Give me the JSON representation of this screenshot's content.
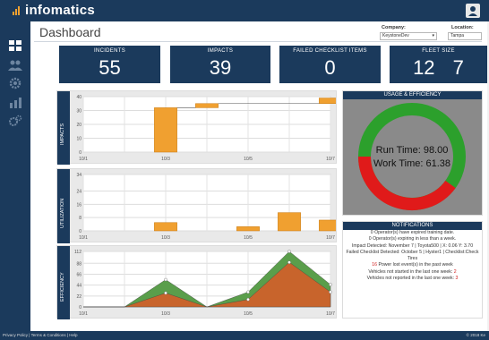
{
  "app": {
    "logo": "infomatics"
  },
  "page": {
    "title": "Dashboard"
  },
  "filters": {
    "company": {
      "label": "Company:",
      "value": "KeystoneDev"
    },
    "location": {
      "label": "Location:",
      "value": "Tampa"
    }
  },
  "kpis": [
    {
      "label": "INCIDENTS",
      "value": "55"
    },
    {
      "label": "IMPACTS",
      "value": "39"
    },
    {
      "label": "FAILED CHECKLIST ITEMS",
      "value": "0"
    },
    {
      "label": "FLEET SIZE",
      "value": "12",
      "value2": "7"
    }
  ],
  "sidebar": {
    "items": [
      {
        "icon": "dashboard-icon"
      },
      {
        "icon": "users-icon"
      },
      {
        "icon": "settings-icon"
      },
      {
        "icon": "reports-icon"
      },
      {
        "icon": "gears-icon"
      }
    ]
  },
  "usage": {
    "header": "USAGE & EFFICIENCY",
    "run_time": "Run Time: 98.00",
    "work_time": "Work Time: 61.38",
    "colors": {
      "run": "#2ca02c",
      "work": "#e01a1a",
      "panel": "#8a8a8a"
    }
  },
  "notifications": {
    "header": "NOTIFICATIONS",
    "lines": [
      {
        "text": "0 Operator(s) have expired training date.",
        "alert": false
      },
      {
        "text": "0 Operator(s) expiring in less than a week.",
        "alert": false
      },
      {
        "text": "Impact Detected: November 7 | Toyota500 | X: 0.06 Y: 3.70",
        "alert": false
      },
      {
        "text": "Failed Checklist Detected: October 5 | Hyster1 | Checklist:Check Tires",
        "alert": false
      },
      {
        "prefix": "16",
        "text": " Power lost event(s) in the past week",
        "alert": true
      },
      {
        "text": "Vehicles not started in the last one week: ",
        "suffix": "2",
        "alert": true
      },
      {
        "text": "Vehicles not reported in the last one week: ",
        "suffix": "3",
        "alert": true
      }
    ]
  },
  "footer": {
    "links": "Privacy Policy | Terms & Conditions | Help",
    "copyright": "© 2018 Ke"
  },
  "chart_data": [
    {
      "type": "bar",
      "ylabel": "IMPACTS",
      "x_ticks": [
        "10/1",
        "10/3",
        "10/5",
        "10/7"
      ],
      "y_ticks": [
        0,
        10,
        20,
        30,
        40
      ],
      "ylim": [
        0,
        40
      ],
      "bars": [
        {
          "x": "10/3",
          "low": 0,
          "high": 32
        },
        {
          "x": "10/4",
          "low": 32,
          "high": 35
        },
        {
          "x": "10/7",
          "low": 35,
          "high": 39
        }
      ],
      "grid": true,
      "colors": {
        "bar": "#f0a030"
      }
    },
    {
      "type": "bar",
      "ylabel": "UTILIZATION",
      "x_ticks": [
        "10/1",
        "10/3",
        "10/5",
        "10/7"
      ],
      "y_ticks": [
        0,
        8,
        16,
        24,
        34
      ],
      "ylim": [
        0,
        34
      ],
      "bars": [
        {
          "x": "10/3",
          "low": 0,
          "high": 5
        },
        {
          "x": "10/5",
          "low": 0,
          "high": 2.5
        },
        {
          "x": "10/6",
          "low": 0,
          "high": 11
        },
        {
          "x": "10/7",
          "low": 0,
          "high": 6.5
        }
      ],
      "grid": true,
      "colors": {
        "bar": "#f0a030"
      }
    },
    {
      "type": "area",
      "ylabel": "EFFICIENCY",
      "x_ticks": [
        "10/1",
        "10/3",
        "10/5",
        "10/7"
      ],
      "y_ticks": [
        0,
        22,
        44,
        66,
        88,
        112
      ],
      "ylim": [
        0,
        112
      ],
      "x": [
        "10/1",
        "10/2",
        "10/3",
        "10/4",
        "10/5",
        "10/6",
        "10/7"
      ],
      "series": [
        {
          "values": [
            0,
            0,
            55,
            0,
            30,
            112,
            45
          ],
          "color": "#5a9e4b"
        },
        {
          "values": [
            0,
            0,
            28,
            0,
            15,
            90,
            30
          ],
          "color": "#c8642c"
        }
      ],
      "grid": true
    }
  ]
}
